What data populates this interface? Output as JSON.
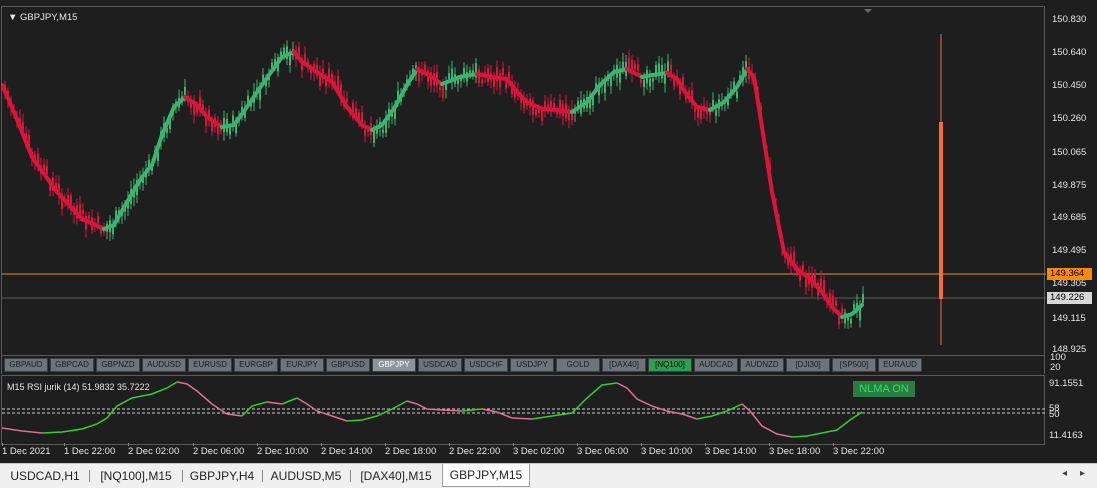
{
  "chart": {
    "title": "GBPJPY,M15",
    "colors": {
      "up": "#3cb371",
      "down": "#dc143c",
      "bg": "#1e1e1e",
      "hline": "#ff8c00",
      "bid_line": "#5a5a5a",
      "bar": "#ff6a3d"
    },
    "price_ticks": [
      "150.830",
      "150.640",
      "150.450",
      "150.260",
      "150.065",
      "149.875",
      "149.685",
      "149.495",
      "149.305",
      "149.115",
      "148.925"
    ],
    "price_current": "149.364",
    "price_bid": "149.226"
  },
  "symbol_buttons": [
    {
      "label": "GBPAUD",
      "state": "normal"
    },
    {
      "label": "GBPCAD",
      "state": "normal"
    },
    {
      "label": "GBPNZD",
      "state": "normal"
    },
    {
      "label": "AUDUSD",
      "state": "normal"
    },
    {
      "label": "EURUSD",
      "state": "normal"
    },
    {
      "label": "EURGBP",
      "state": "normal"
    },
    {
      "label": "EURJPY",
      "state": "normal"
    },
    {
      "label": "GBPUSD",
      "state": "normal"
    },
    {
      "label": "GBPJPY",
      "state": "selected"
    },
    {
      "label": "USDCAD",
      "state": "normal"
    },
    {
      "label": "USDCHF",
      "state": "normal"
    },
    {
      "label": "USDJPY",
      "state": "normal"
    },
    {
      "label": "GOLD",
      "state": "normal"
    },
    {
      "label": "[DAX40]",
      "state": "normal"
    },
    {
      "label": "[NQ100]",
      "state": "green"
    },
    {
      "label": "AUDCAD",
      "state": "normal"
    },
    {
      "label": "AUDNZD",
      "state": "normal"
    },
    {
      "label": "[DJI30]",
      "state": "normal"
    },
    {
      "label": "[SP500]",
      "state": "normal"
    },
    {
      "label": "EURAUD",
      "state": "normal"
    }
  ],
  "button_axis": [
    "100",
    "20"
  ],
  "indicator": {
    "title": "M15  RSI jurik (14) 51.9832 35.7222",
    "toggle_label": "NLMA ON",
    "ticks": [
      "91.1551",
      "58",
      "50",
      "11.4163"
    ],
    "up_color": "#32cd32",
    "down_color": "#db7093"
  },
  "time_ticks": [
    "1 Dec 2021",
    "1 Dec 22:00",
    "2 Dec 02:00",
    "2 Dec 06:00",
    "2 Dec 10:00",
    "2 Dec 14:00",
    "2 Dec 18:00",
    "2 Dec 22:00",
    "3 Dec 02:00",
    "3 Dec 06:00",
    "3 Dec 10:00",
    "3 Dec 14:00",
    "3 Dec 18:00",
    "3 Dec 22:00"
  ],
  "tabs": [
    "USDCAD,H1",
    "[NQ100],M15",
    "GBPJPY,H4",
    "AUDUSD,M5",
    "[DAX40],M15",
    "GBPJPY,M15"
  ],
  "active_tab": "GBPJPY,M15",
  "tab_arrows": {
    "left": "◂",
    "right": "▸"
  }
}
